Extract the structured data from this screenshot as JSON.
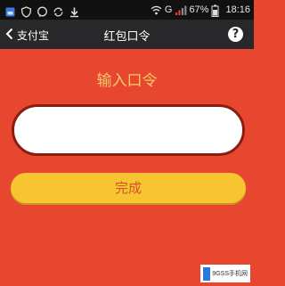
{
  "status_bar": {
    "network_label": "G",
    "battery": "67%",
    "time": "18:16",
    "left_icons": [
      "photo-icon",
      "shield-icon",
      "chat-icon",
      "sync-icon",
      "download-icon"
    ]
  },
  "nav": {
    "back_label": "支付宝",
    "title": "红包口令",
    "help_glyph": "?"
  },
  "main": {
    "heading": "输入口令",
    "input_value": "",
    "done_label": "完成"
  },
  "watermark": {
    "text": "9GSS手机网"
  },
  "colors": {
    "background": "#e8472f",
    "nav_bar": "#28282b",
    "heading": "#f7c96d",
    "button": "#f6c531",
    "button_text": "#d2552a",
    "input_border": "#8b1d10"
  }
}
